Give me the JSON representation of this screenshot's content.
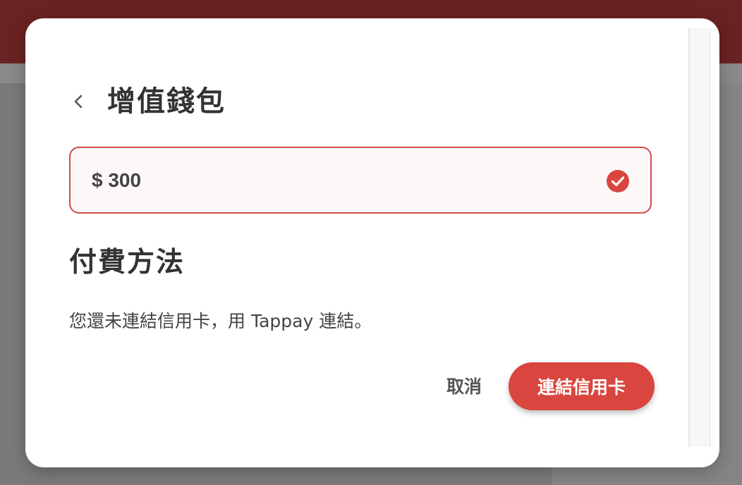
{
  "dialog": {
    "title": "增值錢包",
    "back_icon": "chevron-left-icon",
    "amount": {
      "value": "$ 300",
      "status_icon": "check-circle-icon",
      "accent_color": "#d24b4a"
    },
    "payment_section_title": "付費方法",
    "payment_info": "您還未連結信用卡，用 Tappay 連結。",
    "cancel_label": "取消",
    "link_card_label": "連結信用卡",
    "primary_color": "#d9463f"
  }
}
